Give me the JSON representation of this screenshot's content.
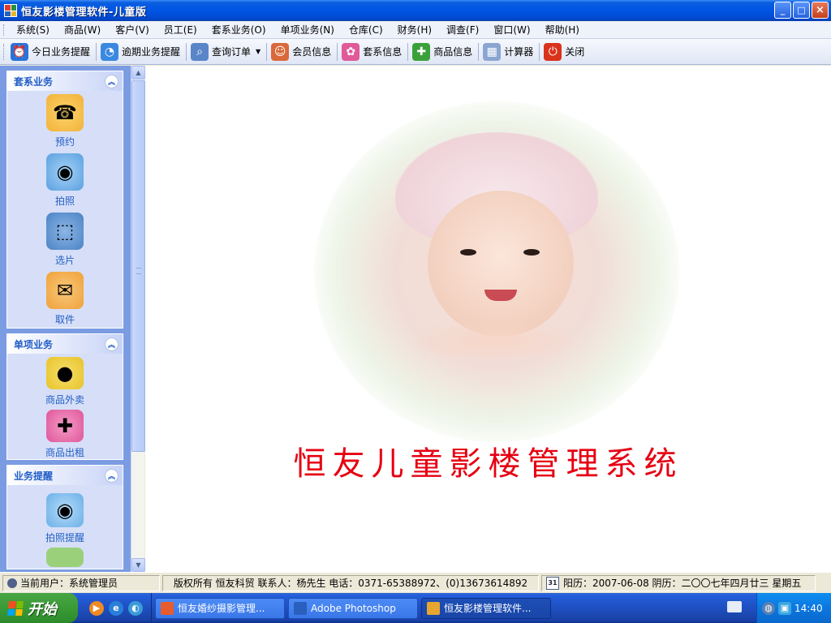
{
  "window": {
    "title": "恒友影楼管理软件-儿童版",
    "controls": [
      "_",
      "□",
      "×"
    ]
  },
  "menubar": [
    "系统(S)",
    "商品(W)",
    "客户(V)",
    "员工(E)",
    "套系业务(O)",
    "单项业务(N)",
    "仓库(C)",
    "财务(H)",
    "调查(F)",
    "窗口(W)",
    "帮助(H)"
  ],
  "toolbar": [
    {
      "label": "今日业务提醒",
      "icon": "alarm-clock-icon",
      "color": "#2a73d9",
      "glyph": "⏰"
    },
    {
      "label": "逾期业务提醒",
      "icon": "overdue-clock-icon",
      "color": "#3a88e0",
      "glyph": "◔"
    },
    {
      "label": "查询订单",
      "icon": "magnifier-icon",
      "color": "#5a86c9",
      "glyph": "🔍",
      "dropdown": true
    },
    {
      "label": "会员信息",
      "icon": "members-icon",
      "color": "#d9683a",
      "glyph": "👥"
    },
    {
      "label": "套系信息",
      "icon": "package-icon",
      "color": "#e05a9a",
      "glyph": "🎁"
    },
    {
      "label": "商品信息",
      "icon": "gift-box-icon",
      "color": "#3aa13a",
      "glyph": "🎁"
    },
    {
      "label": "计算器",
      "icon": "calculator-icon",
      "color": "#8aa6d0",
      "glyph": "🖩"
    },
    {
      "label": "关闭",
      "icon": "power-icon",
      "color": "#d9331c",
      "glyph": "⏻"
    }
  ],
  "sidebar": {
    "groups": [
      {
        "title": "套系业务",
        "items": [
          {
            "label": "预约",
            "icon": "telephone-icon",
            "bg": "#f2b13a",
            "glyph": "☎"
          },
          {
            "label": "拍照",
            "icon": "camera-icon",
            "bg": "#5aa0e0",
            "glyph": "📷"
          },
          {
            "label": "选片",
            "icon": "photo-loupe-icon",
            "bg": "#4b82c4",
            "glyph": "🖼"
          },
          {
            "label": "取件",
            "icon": "mailbox-icon",
            "bg": "#f0a03a",
            "glyph": "📫"
          }
        ]
      },
      {
        "title": "单项业务",
        "items": [
          {
            "label": "商品外卖",
            "icon": "coins-icon",
            "bg": "#e8c22a",
            "glyph": "🪙"
          },
          {
            "label": "商品出租",
            "icon": "gift-icon",
            "bg": "#e0559a",
            "glyph": "🎁"
          }
        ]
      },
      {
        "title": "业务提醒",
        "items": [
          {
            "label": "拍照提醒",
            "icon": "camera-reminder-icon",
            "bg": "#6ab0e8",
            "glyph": "📷"
          }
        ]
      }
    ]
  },
  "main": {
    "title": "恒友儿童影楼管理系统"
  },
  "statusbar": {
    "user": "当前用户：系统管理员",
    "copyright": "版权所有 恒友科贸 联系人：杨先生 电话：0371-65388972、(0)13673614892",
    "calendar_icon_text": "31",
    "date": "阳历：2007-06-08 阴历：二〇〇七年四月廿三 星期五"
  },
  "taskbar": {
    "start_label": "开始",
    "tasks": [
      {
        "label": "恒友婚纱摄影管理...",
        "icon_color": "#e65c2f",
        "active": false
      },
      {
        "label": "Adobe Photoshop",
        "icon_color": "#2a5fbe",
        "active": false
      },
      {
        "label": "恒友影楼管理软件...",
        "icon_color": "#e6a52f",
        "active": true
      }
    ],
    "clock": "14:40"
  }
}
